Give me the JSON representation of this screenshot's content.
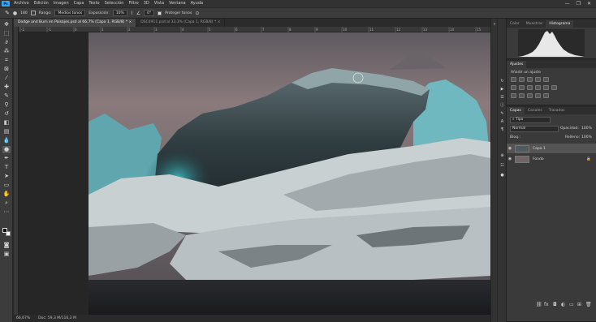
{
  "app": {
    "logo": "Ps"
  },
  "menu": [
    "Archivo",
    "Edición",
    "Imagen",
    "Capa",
    "Texto",
    "Selección",
    "Filtro",
    "3D",
    "Vista",
    "Ventana",
    "Ayuda"
  ],
  "window_controls": [
    "—",
    "❐",
    "✕"
  ],
  "options": {
    "brush_size": "180",
    "range_label": "Rango:",
    "range_value": "Medios tonos",
    "exposure_label": "Exposición:",
    "exposure_value": "10%",
    "angle_value": "0°",
    "protect_label": "Proteger tonos"
  },
  "tabs": [
    {
      "label": "Dodge and Burn en Paisajes.psd al 66,7% (Capa 1, RGB/8) *",
      "close": "×"
    },
    {
      "label": "DSC4911.psd al 33,3% (Capa 1, RGB/8) *",
      "close": "×"
    }
  ],
  "ruler": {
    "ticks": [
      "-2",
      "-1",
      "0",
      "1",
      "2",
      "3",
      "4",
      "5",
      "6",
      "7",
      "8",
      "9",
      "10",
      "11",
      "12",
      "13",
      "14",
      "15",
      "16"
    ]
  },
  "status": {
    "zoom": "66,67%",
    "doc": "Doc: 59,3 M/116,3 M"
  },
  "panels": {
    "top_tabs": [
      "Color",
      "Muestras",
      "Histograma"
    ],
    "adjust_tabs": [
      "Ajustes"
    ],
    "adjust_label": "Añadir un ajuste",
    "layer_tabs": [
      "Capas",
      "Canales",
      "Trazados"
    ],
    "kind_filter": "Tipo",
    "blend_mode": "Normal",
    "opacity_label": "Opacidad:",
    "opacity_value": "100%",
    "lock_label": "Bloq.:",
    "fill_label": "Relleno:",
    "fill_value": "100%",
    "layers": [
      {
        "name": "Capa 1",
        "selected": true
      },
      {
        "name": "Fondo",
        "selected": false
      }
    ]
  },
  "icon_names": [
    "eye-icon",
    "lock-icon",
    "link-icon",
    "fx-icon",
    "mask-icon",
    "adjust-icon",
    "folder-icon",
    "new-layer-icon",
    "trash-icon"
  ]
}
